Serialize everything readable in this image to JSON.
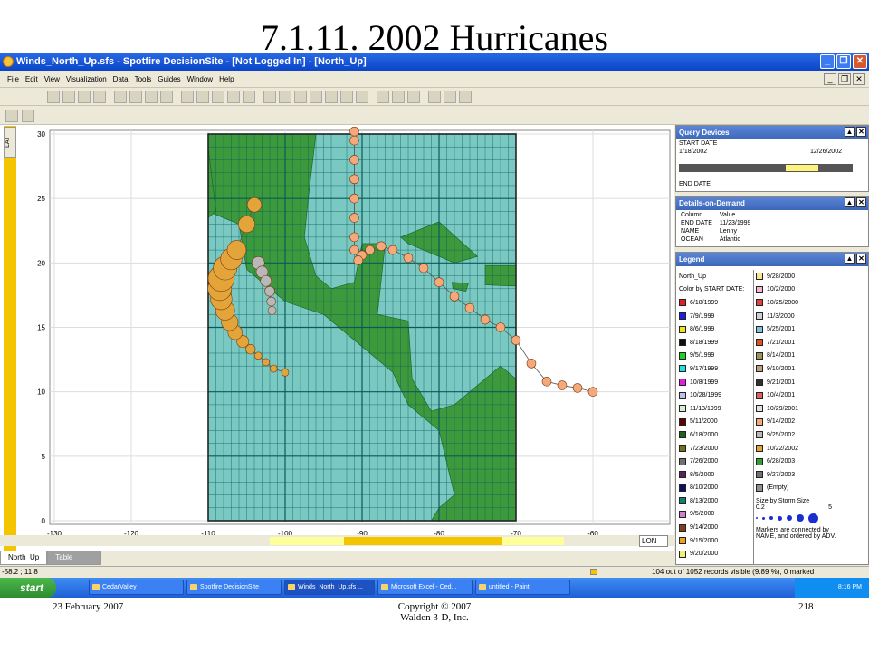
{
  "slide": {
    "title": "7.1.11. 2002 Hurricanes",
    "footer_date": "23 February 2007",
    "footer_copyright_1": "Copyright © 2007",
    "footer_copyright_2": "Walden 3-D, Inc.",
    "footer_page": "218"
  },
  "window": {
    "title": "Winds_North_Up.sfs - Spotfire DecisionSite - [Not Logged In] - [North_Up]",
    "menu": [
      "File",
      "Edit",
      "View",
      "Visualization",
      "Data",
      "Tools",
      "Guides",
      "Window",
      "Help"
    ]
  },
  "plot": {
    "y_axis_label": "LAT",
    "x_axis_selector": "LON",
    "x_ticks": [
      "-130",
      "-120",
      "-110",
      "-100",
      "-90",
      "-80",
      "-70",
      "-60"
    ],
    "y_ticks": [
      "30",
      "25",
      "20",
      "15",
      "10",
      "5",
      "0"
    ],
    "xlim": [
      -130,
      -55
    ],
    "ylim": [
      0,
      30
    ],
    "colors": {
      "track_orange": "#f5a97a",
      "track_gold": "#e3a53a",
      "track_gray": "#b8b8b8",
      "grid": "#0a5a5a",
      "water": "#79c9c2"
    }
  },
  "chart_data": {
    "type": "scatter",
    "xlabel": "LON",
    "ylabel": "LAT",
    "xlim": [
      -130,
      -55
    ],
    "ylim": [
      0,
      30
    ],
    "series": [
      {
        "name": "9/14/2002",
        "color": "#f5a97a",
        "points": [
          [
            -60,
            10
          ],
          [
            -62,
            10.3
          ],
          [
            -64,
            10.5
          ],
          [
            -66,
            10.8
          ],
          [
            -68,
            12.2
          ],
          [
            -70,
            14
          ],
          [
            -72,
            15
          ],
          [
            -74,
            15.6
          ],
          [
            -76,
            16.5
          ],
          [
            -78,
            17.4
          ],
          [
            -80,
            18.5
          ],
          [
            -82,
            19.6
          ],
          [
            -84,
            20.4
          ],
          [
            -86,
            21
          ],
          [
            -87.5,
            21.3
          ],
          [
            -89,
            21
          ],
          [
            -90,
            20.6
          ],
          [
            -90.5,
            20.2
          ],
          [
            -91,
            21
          ],
          [
            -91,
            22
          ],
          [
            -91,
            23.5
          ],
          [
            -91,
            25
          ],
          [
            -91,
            26.5
          ],
          [
            -91,
            28
          ],
          [
            -91,
            29.5
          ],
          [
            -91,
            30.2
          ]
        ]
      },
      {
        "name": "10/22/2002",
        "color": "#e3a53a",
        "points": [
          [
            -100,
            11.5
          ],
          [
            -101.5,
            11.8
          ],
          [
            -102.5,
            12.3
          ],
          [
            -103.5,
            12.8
          ],
          [
            -104.5,
            13.3
          ],
          [
            -105.5,
            13.9
          ],
          [
            -106.5,
            14.6
          ],
          [
            -107.2,
            15.4
          ],
          [
            -107.8,
            16.3
          ],
          [
            -108.3,
            17.2
          ],
          [
            -108.5,
            18
          ],
          [
            -108.3,
            18.8
          ],
          [
            -107.8,
            19.6
          ],
          [
            -107,
            20.3
          ],
          [
            -106.3,
            21
          ],
          [
            -105,
            23
          ],
          [
            -104,
            24.5
          ]
        ]
      },
      {
        "name": "9/25/2002",
        "color": "#b8b8b8",
        "points": [
          [
            -103.5,
            20
          ],
          [
            -103,
            19.3
          ],
          [
            -102.5,
            18.6
          ],
          [
            -102,
            17.8
          ],
          [
            -101.8,
            17
          ],
          [
            -101.7,
            16.3
          ]
        ]
      }
    ]
  },
  "query_devices": {
    "title": "Query Devices",
    "start_label": "START DATE",
    "start_min": "1/18/2002",
    "start_max": "12/26/2002",
    "end_label": "END DATE"
  },
  "details": {
    "title": "Details-on-Demand",
    "headers": [
      "Column",
      "Value"
    ],
    "rows": [
      [
        "END DATE",
        "11/23/1999"
      ],
      [
        "NAME",
        "Lenny"
      ],
      [
        "OCEAN",
        "Atlantic"
      ]
    ]
  },
  "legend": {
    "title": "Legend",
    "view_name": "North_Up",
    "color_by": "Color by START DATE:",
    "items_col1": [
      {
        "label": "6/18/1999",
        "color": "#e02020"
      },
      {
        "label": "7/9/1999",
        "color": "#2020e0"
      },
      {
        "label": "8/6/1999",
        "color": "#f0e020"
      },
      {
        "label": "8/18/1999",
        "color": "#101010"
      },
      {
        "label": "9/5/1999",
        "color": "#20d020"
      },
      {
        "label": "9/17/1999",
        "color": "#20e0e0"
      },
      {
        "label": "10/8/1999",
        "color": "#e020e0"
      },
      {
        "label": "10/28/1999",
        "color": "#c0c0f0"
      },
      {
        "label": "11/13/1999",
        "color": "#d0f0d0"
      },
      {
        "label": "5/11/2000",
        "color": "#600000"
      },
      {
        "label": "6/18/2000",
        "color": "#206020"
      },
      {
        "label": "7/23/2000",
        "color": "#707020"
      },
      {
        "label": "7/26/2000",
        "color": "#707070"
      },
      {
        "label": "8/5/2000",
        "color": "#602060"
      },
      {
        "label": "8/10/2000",
        "color": "#101060"
      },
      {
        "label": "8/13/2000",
        "color": "#108070"
      },
      {
        "label": "9/5/2000",
        "color": "#d080d0"
      },
      {
        "label": "9/14/2000",
        "color": "#804020"
      },
      {
        "label": "9/15/2000",
        "color": "#f0a020"
      },
      {
        "label": "9/20/2000",
        "color": "#f0f070"
      }
    ],
    "items_col2": [
      {
        "label": "9/28/2000",
        "color": "#f5e690"
      },
      {
        "label": "10/2/2000",
        "color": "#f5b5d5"
      },
      {
        "label": "10/25/2000",
        "color": "#e04040"
      },
      {
        "label": "11/3/2000",
        "color": "#d0d0d0"
      },
      {
        "label": "5/25/2001",
        "color": "#80c0e0"
      },
      {
        "label": "7/21/2001",
        "color": "#e05020"
      },
      {
        "label": "8/14/2001",
        "color": "#a09060"
      },
      {
        "label": "9/10/2001",
        "color": "#c0a080"
      },
      {
        "label": "9/21/2001",
        "color": "#303030"
      },
      {
        "label": "10/4/2001",
        "color": "#e06060"
      },
      {
        "label": "10/29/2001",
        "color": "#e0e0e0"
      },
      {
        "label": "9/14/2002",
        "color": "#f5a97a"
      },
      {
        "label": "9/25/2002",
        "color": "#b8b8b8"
      },
      {
        "label": "10/22/2002",
        "color": "#e3a53a"
      },
      {
        "label": "6/28/2003",
        "color": "#30a030"
      },
      {
        "label": "9/27/2003",
        "color": "#707070"
      },
      {
        "label": "(Empty)",
        "color": "#909090"
      }
    ],
    "size_label": "Size by Storm Size",
    "size_min": "0.2",
    "size_max": "5",
    "connected_note_1": "Markers are connected by",
    "connected_note_2": "NAME, and ordered by ADV."
  },
  "tabs": {
    "map_tab": "North_Up",
    "table_tab": "Table"
  },
  "status": {
    "coords": "-58.2 ; 11.8",
    "records": "104 out of 1052 records visible (9.89 %), 0 marked"
  },
  "taskbar": {
    "start": "start",
    "tasks": [
      "CedarValley",
      "Spotfire DecisionSite",
      "Winds_North_Up.sfs ...",
      "Microsoft Excel - Ced...",
      "untitled - Paint"
    ],
    "clock": "8:16 PM"
  }
}
